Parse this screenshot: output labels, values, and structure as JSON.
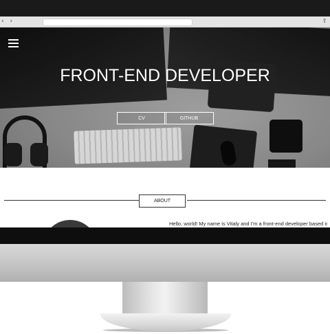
{
  "browser": {
    "nav_arrows": "‹ ›",
    "share_icon": "share-icon"
  },
  "hero": {
    "title": "FRONT-END DEVELOPER",
    "menu_icon": "hamburger-menu-icon",
    "buttons": {
      "cv": "CV",
      "github": "GITHUB"
    }
  },
  "about": {
    "label": "ABOUT",
    "text": "Hello, world! My name is Vitaly and I'm a front-end developer based in"
  },
  "colors": {
    "hero_text": "#ffffff",
    "divider": "#333333",
    "bezel": "#1a1a1a"
  }
}
